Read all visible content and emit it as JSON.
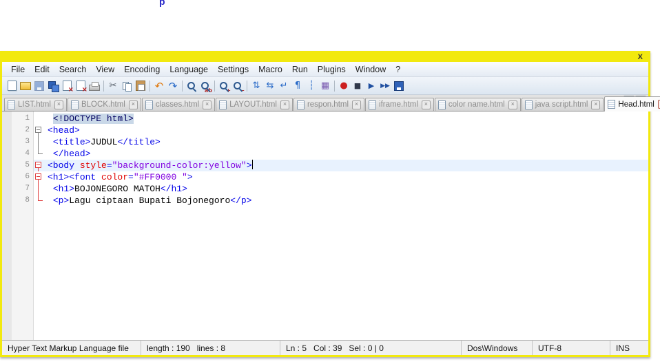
{
  "page": {
    "stray_text": "p"
  },
  "window": {
    "close_label": "X",
    "border_color": "#F2E90E"
  },
  "menubar": {
    "items": [
      "File",
      "Edit",
      "Search",
      "View",
      "Encoding",
      "Language",
      "Settings",
      "Macro",
      "Run",
      "Plugins",
      "Window",
      "?"
    ]
  },
  "toolbar": {
    "items": [
      {
        "name": "new-file",
        "shape": "page"
      },
      {
        "name": "open-folder",
        "shape": "folder"
      },
      {
        "name": "save",
        "shape": "floppy",
        "dim": true
      },
      {
        "name": "save-all",
        "shape": "floppy2"
      },
      {
        "name": "close",
        "shape": "page-x"
      },
      {
        "name": "close-all",
        "shape": "page-x2"
      },
      {
        "name": "print",
        "shape": "printer"
      },
      {
        "sep": true
      },
      {
        "name": "cut",
        "glyph": "✂",
        "color": "#58616B"
      },
      {
        "name": "copy",
        "shape": "copy"
      },
      {
        "name": "paste",
        "shape": "paste"
      },
      {
        "sep": true
      },
      {
        "name": "undo",
        "glyph": "↶",
        "color": "#E07A10",
        "size": 15
      },
      {
        "name": "redo",
        "glyph": "↷",
        "color": "#2A6BC8",
        "size": 15
      },
      {
        "sep": true
      },
      {
        "name": "find",
        "shape": "magnifier"
      },
      {
        "name": "replace",
        "shape": "magnifier",
        "sub": "ab"
      },
      {
        "sep": true
      },
      {
        "name": "zoom-in",
        "shape": "magnifier",
        "sub": "+"
      },
      {
        "name": "zoom-out",
        "shape": "magnifier",
        "sub": "−"
      },
      {
        "sep": true
      },
      {
        "name": "sync-vertical",
        "glyph": "⇅",
        "color": "#2A6BC8"
      },
      {
        "name": "sync-horizontal",
        "glyph": "⇆",
        "color": "#2A6BC8"
      },
      {
        "name": "word-wrap",
        "glyph": "↵",
        "color": "#2A6BC8"
      },
      {
        "name": "show-all-characters",
        "glyph": "¶",
        "color": "#2A6BC8"
      },
      {
        "name": "indent-guide",
        "glyph": "┆",
        "color": "#2A6BC8"
      },
      {
        "name": "user-defined-dialog",
        "glyph": "▦",
        "color": "#7A5AB0"
      },
      {
        "sep": true
      },
      {
        "name": "record-macro",
        "glyph": "●",
        "color": "#CC2020"
      },
      {
        "name": "stop-record",
        "glyph": "■",
        "color": "#30384A",
        "size": 11
      },
      {
        "name": "playback-macro",
        "glyph": "▶",
        "color": "#1F4FA0",
        "size": 11
      },
      {
        "name": "run-macro-multiple",
        "glyph": "▶▶",
        "color": "#1F4FA0",
        "size": 9
      },
      {
        "name": "save-macro",
        "shape": "floppy"
      }
    ]
  },
  "tabs": {
    "close_glyph": "×",
    "scroll_left": "◄",
    "scroll_right": "►",
    "items": [
      {
        "label": "LIST.html",
        "active": false
      },
      {
        "label": "BLOCK.html",
        "active": false
      },
      {
        "label": "classes.html",
        "active": false
      },
      {
        "label": "LAYOUT.html",
        "active": false
      },
      {
        "label": "respon.html",
        "active": false
      },
      {
        "label": "iframe.html",
        "active": false
      },
      {
        "label": "color name.html",
        "active": false
      },
      {
        "label": "java script.html",
        "active": false
      },
      {
        "label": "Head.html",
        "active": true
      }
    ]
  },
  "editor": {
    "colors": {
      "tag": "#0000E8",
      "attr": "#E00000",
      "value": "#8000E0",
      "text": "#000000",
      "doctype_fg": "#000060",
      "doctype_bg": "#C9D8E8",
      "current_line_bg": "#E8F2FE"
    },
    "lines": [
      {
        "num": "1",
        "fold": "none",
        "current": false,
        "segments": [
          {
            "t": " ",
            "s": "text"
          },
          {
            "t": "<!DOCTYPE html>",
            "s": "doctype"
          }
        ]
      },
      {
        "num": "2",
        "fold": "open",
        "current": false,
        "segments": [
          {
            "t": "<head>",
            "s": "tag"
          }
        ]
      },
      {
        "num": "3",
        "fold": "line",
        "current": false,
        "segments": [
          {
            "t": " ",
            "s": "text"
          },
          {
            "t": "<title>",
            "s": "tag"
          },
          {
            "t": "JUDUL",
            "s": "text"
          },
          {
            "t": "</title>",
            "s": "tag"
          }
        ]
      },
      {
        "num": "4",
        "fold": "end",
        "current": false,
        "segments": [
          {
            "t": " ",
            "s": "text"
          },
          {
            "t": "</head>",
            "s": "tag"
          }
        ]
      },
      {
        "num": "5",
        "fold": "open-red",
        "current": true,
        "segments": [
          {
            "t": "<body ",
            "s": "tag"
          },
          {
            "t": "style",
            "s": "attr"
          },
          {
            "t": "=",
            "s": "tag"
          },
          {
            "t": "\"background-color:yellow\"",
            "s": "value"
          },
          {
            "t": ">",
            "s": "tag"
          }
        ]
      },
      {
        "num": "6",
        "fold": "open-red",
        "current": false,
        "segments": [
          {
            "t": "<h1>",
            "s": "tag"
          },
          {
            "t": "<font ",
            "s": "tag"
          },
          {
            "t": "color",
            "s": "attr"
          },
          {
            "t": "=",
            "s": "tag"
          },
          {
            "t": "\"#FF0000 \"",
            "s": "value"
          },
          {
            "t": ">",
            "s": "tag"
          }
        ]
      },
      {
        "num": "7",
        "fold": "line-red",
        "current": false,
        "segments": [
          {
            "t": " ",
            "s": "text"
          },
          {
            "t": "<h1>",
            "s": "tag"
          },
          {
            "t": "BOJONEGORO MATOH",
            "s": "text"
          },
          {
            "t": "</h1>",
            "s": "tag"
          }
        ]
      },
      {
        "num": "8",
        "fold": "end-red",
        "current": false,
        "segments": [
          {
            "t": " ",
            "s": "text"
          },
          {
            "t": "<p>",
            "s": "tag"
          },
          {
            "t": "Lagu ciptaan Bupati Bojonegoro",
            "s": "text"
          },
          {
            "t": "</p>",
            "s": "tag"
          }
        ]
      }
    ]
  },
  "statusbar": {
    "doc_type": "Hyper Text Markup Language file",
    "length_lines": "length : 190   lines : 8",
    "cursor": "Ln : 5   Col : 39   Sel : 0 | 0",
    "eol": "Dos\\Windows",
    "encoding": "UTF-8",
    "mode": "INS"
  }
}
